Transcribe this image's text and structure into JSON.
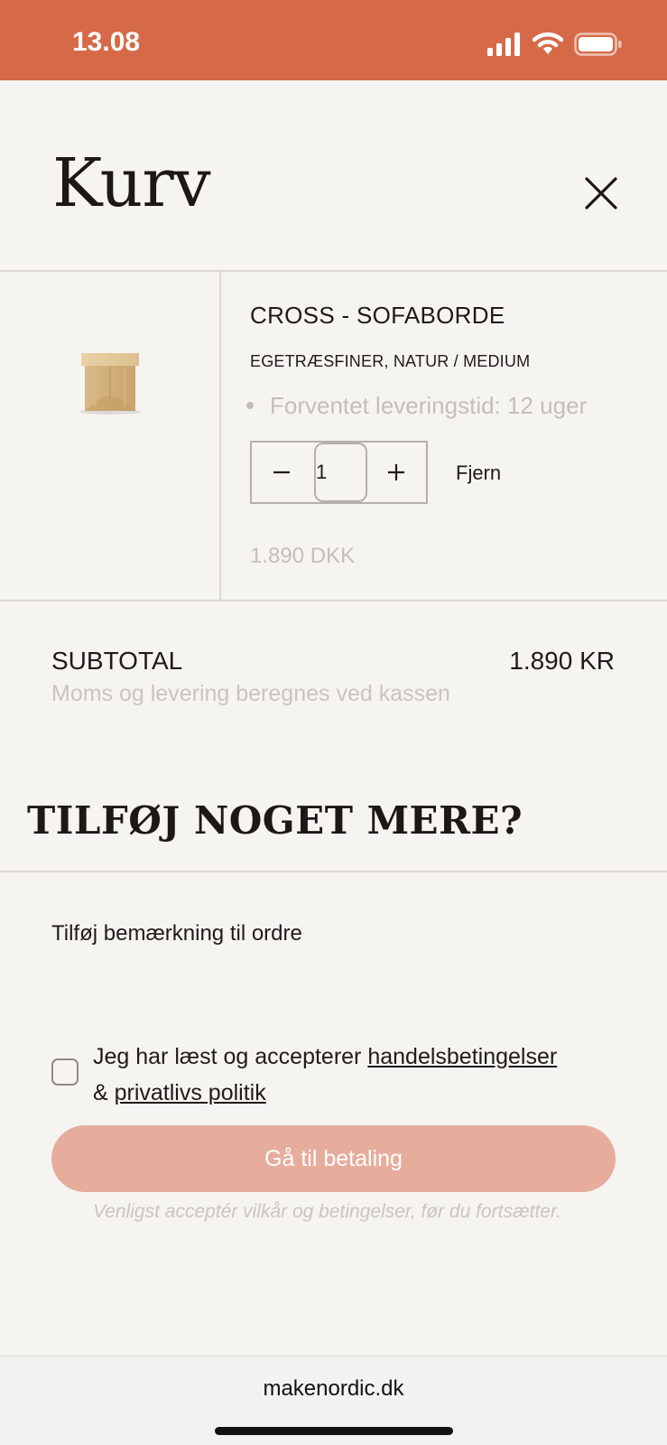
{
  "status_bar": {
    "time": "13.08",
    "background": "#d66a48",
    "icons": [
      "signal-icon",
      "wifi-icon",
      "battery-icon"
    ]
  },
  "header": {
    "title": "Kurv",
    "close_icon": "close-icon"
  },
  "cart_item": {
    "image_icon": "product-thumbnail",
    "name": "CROSS - SOFABORDE",
    "variant": "EGETRÆSFINER, NATUR / MEDIUM",
    "delivery": "Forventet leveringstid: 12 uger",
    "quantity": "1",
    "minus_icon": "minus-icon",
    "plus_icon": "plus-icon",
    "remove_label": "Fjern",
    "price": "1.890 DKK"
  },
  "summary": {
    "subtotal_label": "SUBTOTAL",
    "subtotal_value": "1.890 KR",
    "note": "Moms og levering beregnes ved kassen"
  },
  "upsell": {
    "heading": "TILFØJ NOGET MERE?"
  },
  "order_note": {
    "label": "Tilføj bemærkning til ordre"
  },
  "terms": {
    "prefix": "Jeg har læst og accepterer ",
    "link_terms": "handelsbetingelser",
    "joiner": "& ",
    "link_privacy": "privatlivs politik",
    "checked": false
  },
  "checkout": {
    "button_label": "Gå til betaling",
    "button_color": "#e6ad9d",
    "warning": "Venligst acceptér vilkår og betingelser, før du fortsætter."
  },
  "browser": {
    "url": "makenordic.dk"
  }
}
